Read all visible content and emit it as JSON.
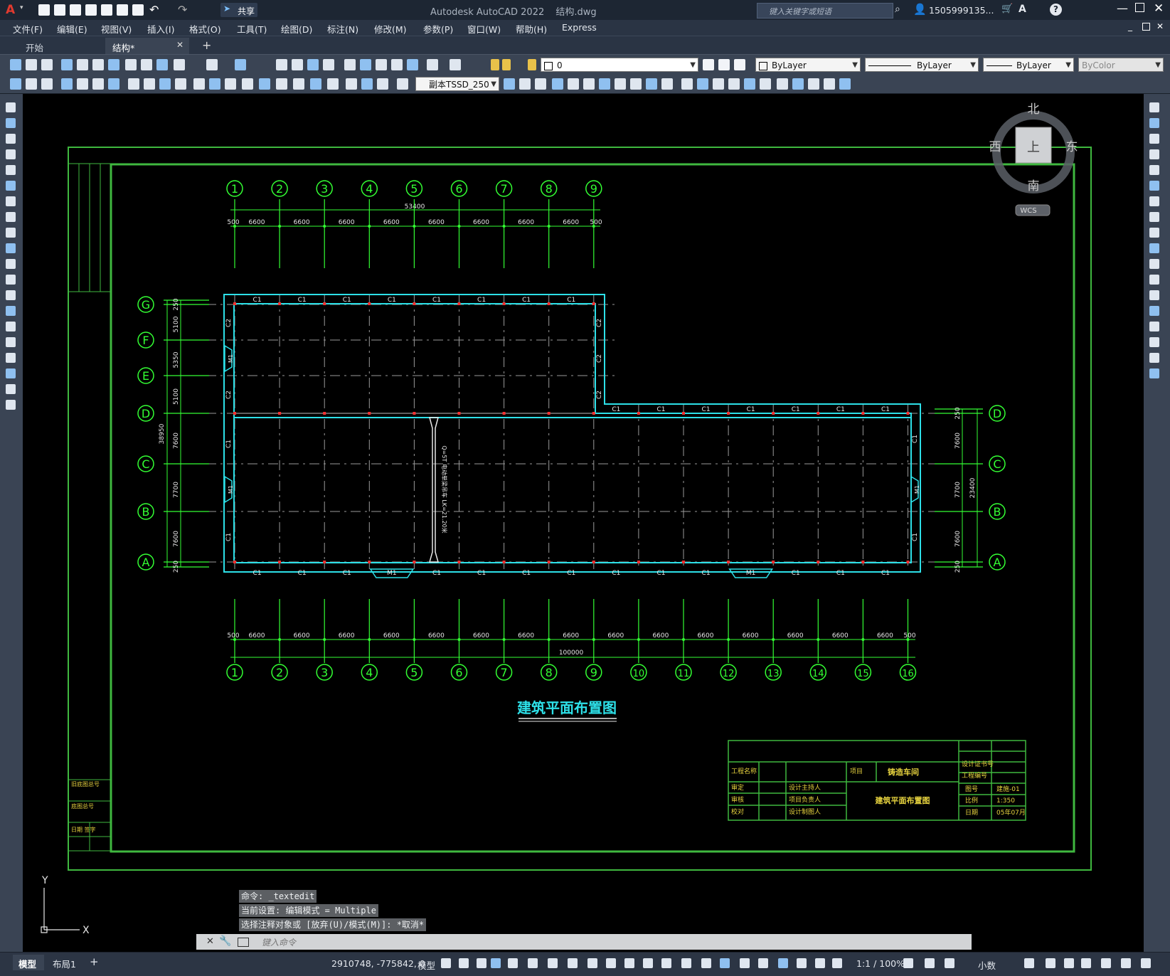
{
  "app": {
    "title": "Autodesk AutoCAD 2022",
    "filename": "结构.dwg",
    "share_label": "共享",
    "search_placeholder": "键入关键字或短语",
    "user": "1505999135...",
    "window_controls": [
      "minimize-icon",
      "maximize-icon",
      "close-icon"
    ]
  },
  "menu": [
    "文件(F)",
    "编辑(E)",
    "视图(V)",
    "插入(I)",
    "格式(O)",
    "工具(T)",
    "绘图(D)",
    "标注(N)",
    "修改(M)",
    "参数(P)",
    "窗口(W)",
    "帮助(H)",
    "Express"
  ],
  "tabs": [
    {
      "label": "开始",
      "active": false
    },
    {
      "label": "结构*",
      "active": true
    }
  ],
  "toolbar": {
    "layer_value": "0",
    "color_value": "ByLayer",
    "linetype_value": "ByLayer",
    "lineweight_value": "ByLayer",
    "plotstyle_value": "ByColor",
    "textstyle_value": "副本TSSD_250"
  },
  "viewcube": {
    "north": "北",
    "south": "南",
    "east": "东",
    "west": "西",
    "top": "上",
    "wcs": "WCS"
  },
  "ucs": {
    "x": "X",
    "y": "Y"
  },
  "drawing": {
    "title": "建筑平面布置图",
    "top_axes": [
      "1",
      "2",
      "3",
      "4",
      "5",
      "6",
      "7",
      "8",
      "9"
    ],
    "bottom_axes": [
      "1",
      "2",
      "3",
      "4",
      "5",
      "6",
      "7",
      "8",
      "9",
      "10",
      "11",
      "12",
      "13",
      "14",
      "15",
      "16"
    ],
    "row_axes_left": [
      "G",
      "F",
      "E",
      "D",
      "C",
      "B",
      "A"
    ],
    "row_axes_right": [
      "D",
      "C",
      "B",
      "A"
    ],
    "top_overall": "53400",
    "bottom_overall": "100000",
    "bay": "6600",
    "edge": "500",
    "left_dims": [
      "250",
      "5100",
      "5350",
      "5100",
      "7600",
      "7700",
      "7600",
      "250"
    ],
    "left_overall": "38950",
    "right_dims": [
      "250",
      "7600",
      "7700",
      "7600",
      "250"
    ],
    "right_overall": "23400",
    "window_tag": "C1",
    "window_tag2": "C2",
    "door_tag": "M1",
    "door_tag2": "M1",
    "crane_note": "Q=5T 电动单梁吊车 LK=21.20米",
    "title_block": {
      "project_label": "工程名称",
      "item_label": "项目",
      "item_value": "铸造车间",
      "drawing_name": "建筑平面布置图",
      "cert_label": "设计证书号",
      "proj_no_label": "工程编号",
      "drawing_no_label": "图号",
      "drawing_no": "建施-01",
      "scale_label": "比例",
      "scale": "1:350",
      "date_label": "日期",
      "date": "05年07月",
      "roles_left": [
        "审定",
        "审核",
        "校对"
      ],
      "roles_mid": [
        "设计主持人",
        "项目负责人",
        "设计制图人"
      ]
    },
    "side_labels": [
      "旧底图总号",
      "底图总号",
      "日期 签字"
    ]
  },
  "command": {
    "history": [
      "命令: _textedit",
      "当前设置: 编辑模式 = Multiple",
      "选择注释对象或 [放弃(U)/模式(M)]: *取消*"
    ],
    "placeholder": "键入命令"
  },
  "status": {
    "tabs": [
      "模型",
      "布局1"
    ],
    "coords": "2910748, -775842, 0",
    "space": "模型",
    "scale": "1:1 / 100%",
    "units": "小数"
  }
}
